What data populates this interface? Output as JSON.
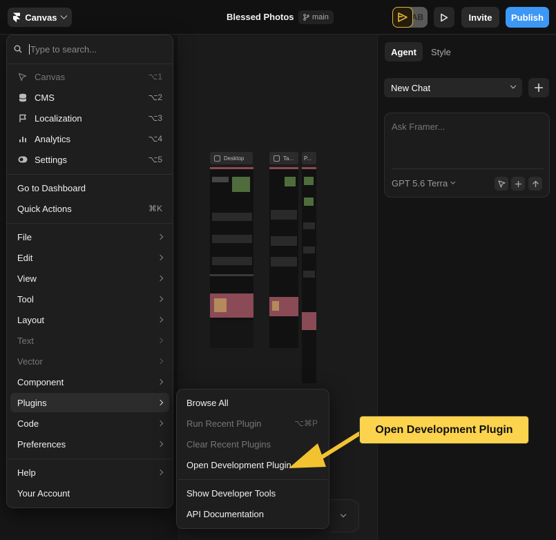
{
  "topbar": {
    "canvas_label": "Canvas",
    "project_title": "Blessed Photos",
    "separator": "·",
    "branch": "main",
    "avatar_initials": "AB",
    "invite": "Invite",
    "publish": "Publish"
  },
  "canvas": {
    "frames": [
      "Desktop",
      "Ta...",
      "P..."
    ]
  },
  "right_panel": {
    "tabs": [
      "Agent",
      "Style"
    ],
    "chat_select": "New Chat",
    "ask_placeholder": "Ask Framer...",
    "model": "GPT 5.6 Terra"
  },
  "menu": {
    "search_placeholder": "Type to search...",
    "modes": [
      {
        "label": "Canvas",
        "shortcut": "⌥1",
        "icon": "cursor-icon",
        "disabled": true
      },
      {
        "label": "CMS",
        "shortcut": "⌥2",
        "icon": "database-icon",
        "disabled": false
      },
      {
        "label": "Localization",
        "shortcut": "⌥3",
        "icon": "flag-icon",
        "disabled": false
      },
      {
        "label": "Analytics",
        "shortcut": "⌥4",
        "icon": "bar-chart-icon",
        "disabled": false
      },
      {
        "label": "Settings",
        "shortcut": "⌥5",
        "icon": "toggle-icon",
        "disabled": false
      }
    ],
    "actions": [
      {
        "label": "Go to Dashboard",
        "shortcut": ""
      },
      {
        "label": "Quick Actions",
        "shortcut": "⌘K"
      }
    ],
    "submenus": [
      {
        "label": "File",
        "disabled": false
      },
      {
        "label": "Edit",
        "disabled": false
      },
      {
        "label": "View",
        "disabled": false
      },
      {
        "label": "Tool",
        "disabled": false
      },
      {
        "label": "Layout",
        "disabled": false
      },
      {
        "label": "Text",
        "disabled": true
      },
      {
        "label": "Vector",
        "disabled": true
      },
      {
        "label": "Component",
        "disabled": false
      },
      {
        "label": "Plugins",
        "disabled": false
      },
      {
        "label": "Code",
        "disabled": false
      },
      {
        "label": "Preferences",
        "disabled": false
      }
    ],
    "footer": [
      {
        "label": "Help",
        "has_submenu": true
      },
      {
        "label": "Your Account",
        "has_submenu": false
      }
    ]
  },
  "plugins_submenu": {
    "items": [
      {
        "label": "Browse All",
        "shortcut": "",
        "disabled": false
      },
      {
        "label": "Run Recent Plugin",
        "shortcut": "⌥⌘P",
        "disabled": true
      },
      {
        "label": "Clear Recent Plugins",
        "shortcut": "",
        "disabled": true
      },
      {
        "label": "Open Development Plugin",
        "shortcut": "",
        "disabled": false
      }
    ],
    "dev_items": [
      {
        "label": "Show Developer Tools"
      },
      {
        "label": "API Documentation"
      }
    ]
  },
  "annotation": {
    "callout_text": "Open Development Plugin",
    "color": "#fcd34d"
  }
}
